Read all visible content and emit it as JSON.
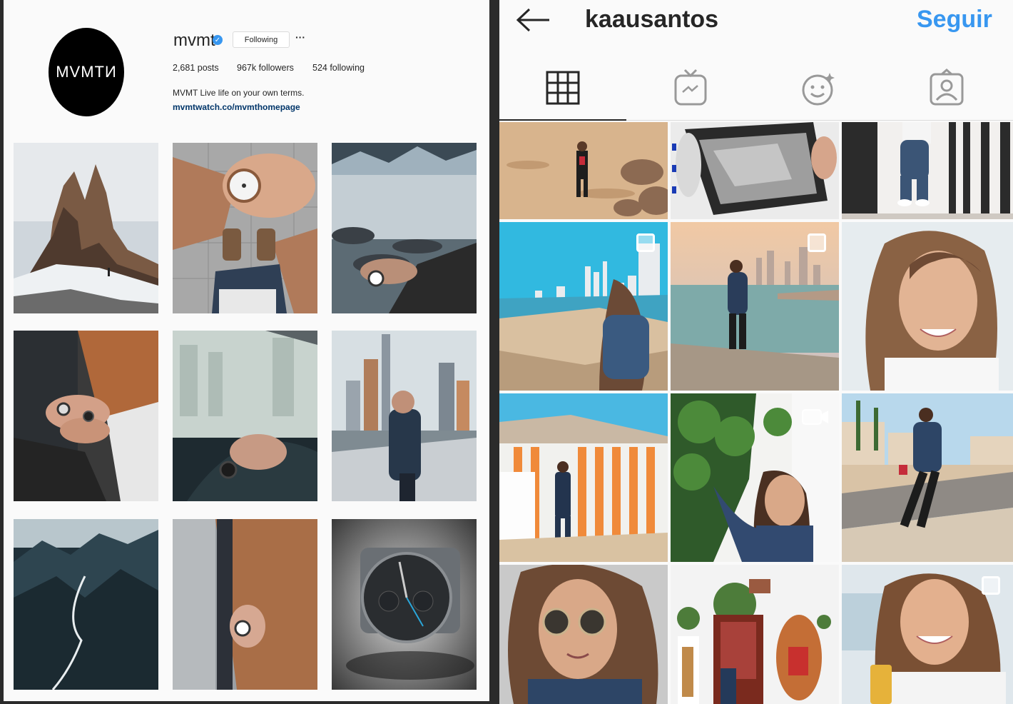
{
  "left_profile": {
    "avatar_text": "MVMTИ",
    "username": "mvmt",
    "verified_icon": "verified-badge-icon",
    "following_label": "Following",
    "more_label": "···",
    "posts": "2,681 posts",
    "followers": "967k followers",
    "following": "524 following",
    "bio": "MVMT Live life on your own terms.",
    "link": "mvmtwatch.co/mvmthomepage",
    "photos": [
      {
        "subject": "mountain peaks snow hiker"
      },
      {
        "subject": "watch on wrist brown coat"
      },
      {
        "subject": "icy lake watch on wrist"
      },
      {
        "subject": "couple holding hands watch"
      },
      {
        "subject": "driving hand on wheel watch"
      },
      {
        "subject": "man in city holding head"
      },
      {
        "subject": "aerial dark mountains river"
      },
      {
        "subject": "brown coat man wrist watch"
      },
      {
        "subject": "black chronograph watch"
      }
    ]
  },
  "right_profile": {
    "back_icon": "back-arrow-icon",
    "username": "kaausantos",
    "follow_label": "Seguir",
    "tabs": [
      {
        "name": "grid",
        "icon": "grid-icon"
      },
      {
        "name": "igtv",
        "icon": "igtv-icon"
      },
      {
        "name": "effects",
        "icon": "effects-smile-icon"
      },
      {
        "name": "tagged",
        "icon": "tagged-person-icon"
      }
    ],
    "photos": [
      {
        "subject": "woman on beach rocks"
      },
      {
        "subject": "unboxing white tissue"
      },
      {
        "subject": "corridor jeans white shoes"
      },
      {
        "subject": "woman sitting beach skyline",
        "badge": "multi"
      },
      {
        "subject": "woman walking harbor sunset",
        "badge": "multi"
      },
      {
        "subject": "woman selfie smiling"
      },
      {
        "subject": "striped beach hut"
      },
      {
        "subject": "woman near plants wall",
        "badge": "video"
      },
      {
        "subject": "woman sitting beach promenade"
      },
      {
        "subject": "woman sunglasses car"
      },
      {
        "subject": "white street plants shop"
      },
      {
        "subject": "woman smiling drink can",
        "badge": "multi"
      }
    ]
  },
  "colors": {
    "accent_blue": "#3897f0",
    "text": "#262626",
    "link": "#003569"
  }
}
